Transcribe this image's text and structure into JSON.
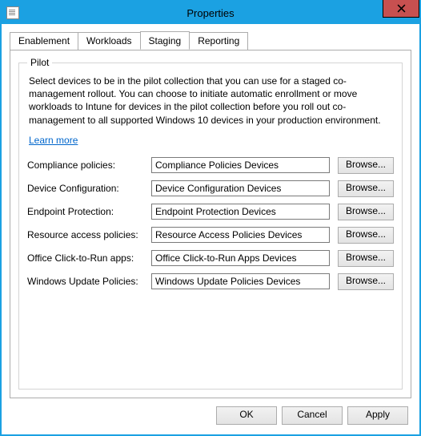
{
  "window": {
    "title": "Properties"
  },
  "tabs": {
    "t0": "Enablement",
    "t1": "Workloads",
    "t2": "Staging",
    "t3": "Reporting"
  },
  "pilot": {
    "legend": "Pilot",
    "description": "Select devices to be in the pilot collection that you can use for a staged co-management rollout. You can choose to initiate automatic enrollment or move workloads to Intune for devices in the pilot collection before you roll out co-management to all supported Windows 10 devices in your production environment.",
    "learn_more": "Learn more",
    "rows": [
      {
        "label": "Compliance policies:",
        "value": "Compliance Policies Devices",
        "btn": "Browse..."
      },
      {
        "label": "Device Configuration:",
        "value": "Device Configuration Devices",
        "btn": "Browse..."
      },
      {
        "label": "Endpoint Protection:",
        "value": "Endpoint Protection Devices",
        "btn": "Browse..."
      },
      {
        "label": "Resource access policies:",
        "value": "Resource Access Policies Devices",
        "btn": "Browse..."
      },
      {
        "label": "Office Click-to-Run apps:",
        "value": "Office Click-to-Run Apps Devices",
        "btn": "Browse..."
      },
      {
        "label": "Windows Update Policies:",
        "value": "Windows Update Policies Devices",
        "btn": "Browse..."
      }
    ]
  },
  "footer": {
    "ok": "OK",
    "cancel": "Cancel",
    "apply": "Apply"
  }
}
